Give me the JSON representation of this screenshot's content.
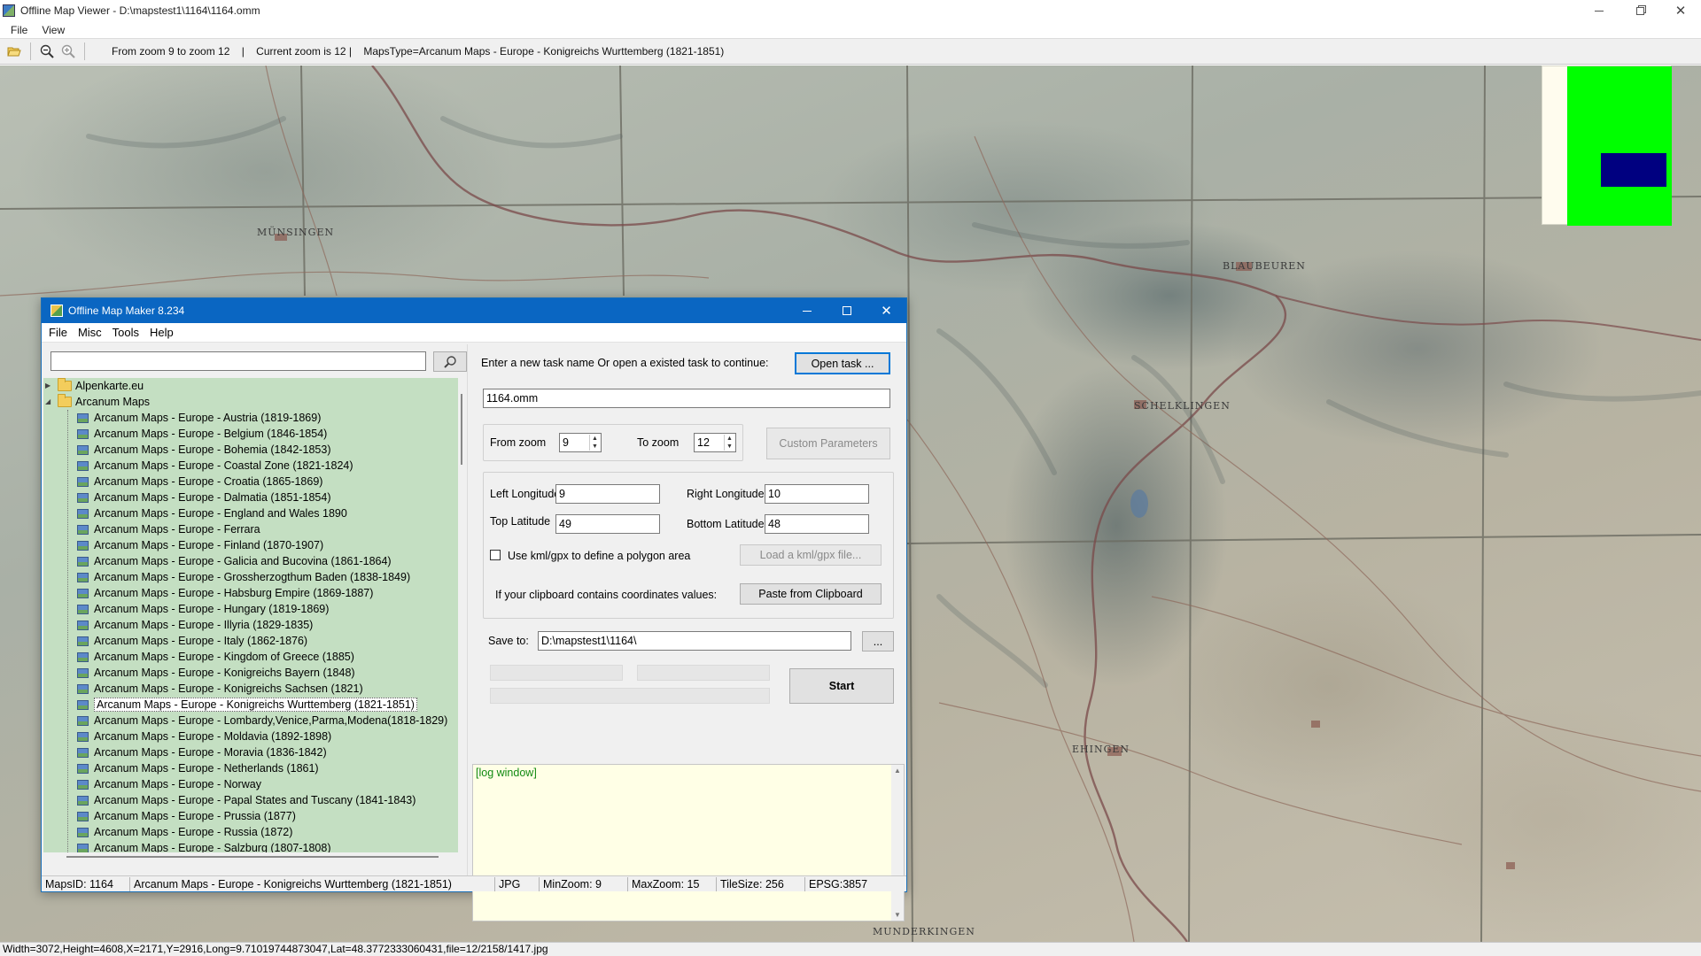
{
  "window": {
    "title": "Offline Map Viewer - D:\\mapstest1\\1164\\1164.omm"
  },
  "menu": [
    "File",
    "View"
  ],
  "toolbar": {
    "status": "From zoom 9 to zoom 12    |    Current zoom is 12 |    MapsType=Arcanum Maps - Europe - Konigreichs Wurttemberg (1821-1851)"
  },
  "map": {
    "labels": [
      "MÜNSINGEN",
      "BLAUBEUREN",
      "SCHELKLINGEN",
      "EHINGEN",
      "MUNDERKINGEN"
    ]
  },
  "bottom_status": "Width=3072,Height=4608,X=2171,Y=2916,Long=9.71019744873047,Lat=48.3772333060431,file=12/2158/1417.jpg",
  "dialog": {
    "title": "Offline Map Maker 8.234",
    "menu": [
      "File",
      "Misc",
      "Tools",
      "Help"
    ],
    "search_placeholder": "",
    "tree": {
      "folders": [
        "Alpenkarte.eu",
        "Arcanum Maps"
      ],
      "items": [
        "Arcanum Maps - Europe - Austria (1819-1869)",
        "Arcanum Maps - Europe - Belgium (1846-1854)",
        "Arcanum Maps - Europe - Bohemia (1842-1853)",
        "Arcanum Maps - Europe - Coastal Zone (1821-1824)",
        "Arcanum Maps - Europe - Croatia (1865-1869)",
        "Arcanum Maps - Europe - Dalmatia (1851-1854)",
        "Arcanum Maps - Europe - England and Wales 1890",
        "Arcanum Maps - Europe - Ferrara",
        "Arcanum Maps - Europe - Finland (1870-1907)",
        "Arcanum Maps - Europe - Galicia and Bucovina (1861-1864)",
        "Arcanum Maps - Europe - Grossherzogthum Baden (1838-1849)",
        "Arcanum Maps - Europe - Habsburg Empire (1869-1887)",
        "Arcanum Maps - Europe - Hungary (1819-1869)",
        "Arcanum Maps - Europe - Illyria (1829-1835)",
        "Arcanum Maps - Europe - Italy (1862-1876)",
        "Arcanum Maps - Europe - Kingdom of Greece (1885)",
        "Arcanum Maps - Europe - Konigreichs Bayern (1848)",
        "Arcanum Maps - Europe - Konigreichs Sachsen (1821)",
        "Arcanum Maps - Europe - Konigreichs Wurttemberg (1821-1851)",
        "Arcanum Maps - Europe - Lombardy,Venice,Parma,Modena(1818-1829)",
        "Arcanum Maps - Europe - Moldavia (1892-1898)",
        "Arcanum Maps - Europe - Moravia (1836-1842)",
        "Arcanum Maps - Europe - Netherlands (1861)",
        "Arcanum Maps - Europe - Norway",
        "Arcanum Maps - Europe - Papal States and Tuscany (1841-1843)",
        "Arcanum Maps - Europe - Prussia (1877)",
        "Arcanum Maps - Europe - Russia (1872)",
        "Arcanum Maps - Europe - Salzburg (1807-1808)"
      ],
      "selected_index": 18
    },
    "task_label": "Enter a new task name Or open a existed task to continue:",
    "open_task_label": "Open task ...",
    "task_name": "1164.omm",
    "from_zoom_label": "From zoom",
    "from_zoom": "9",
    "to_zoom_label": "To zoom",
    "to_zoom": "12",
    "custom_params_label": "Custom Parameters",
    "left_lon_label": "Left Longitude",
    "left_lon": "9",
    "right_lon_label": "Right Longitude",
    "right_lon": "10",
    "top_lat_label": "Top Latitude",
    "top_lat": "49",
    "bottom_lat_label": "Bottom Latitude",
    "bottom_lat": "48",
    "kml_label": "Use kml/gpx to define a polygon area",
    "load_kml_label": "Load a kml/gpx file...",
    "clipboard_label": "If your clipboard contains coordinates values:",
    "paste_label": "Paste from Clipboard",
    "save_to_label": "Save to:",
    "save_to": "D:\\mapstest1\\1164\\",
    "browse_label": "...",
    "start_label": "Start",
    "log_text": "[log window]",
    "status": {
      "maps_id": "MapsID: 1164",
      "maps_name": "Arcanum Maps - Europe - Konigreichs Wurttemberg (1821-1851)",
      "format": "JPG",
      "min_zoom": "MinZoom: 9",
      "max_zoom": "MaxZoom: 15",
      "tile_size": "TileSize: 256",
      "epsg": "EPSG:3857"
    }
  },
  "colors": {
    "dialog_title_bg": "#0a66c2",
    "tree_bg": "#c4dfc2",
    "overview_green": "#00ff00",
    "overview_view": "#000080",
    "log_bg": "#ffffe6",
    "log_text": "#128a12"
  }
}
